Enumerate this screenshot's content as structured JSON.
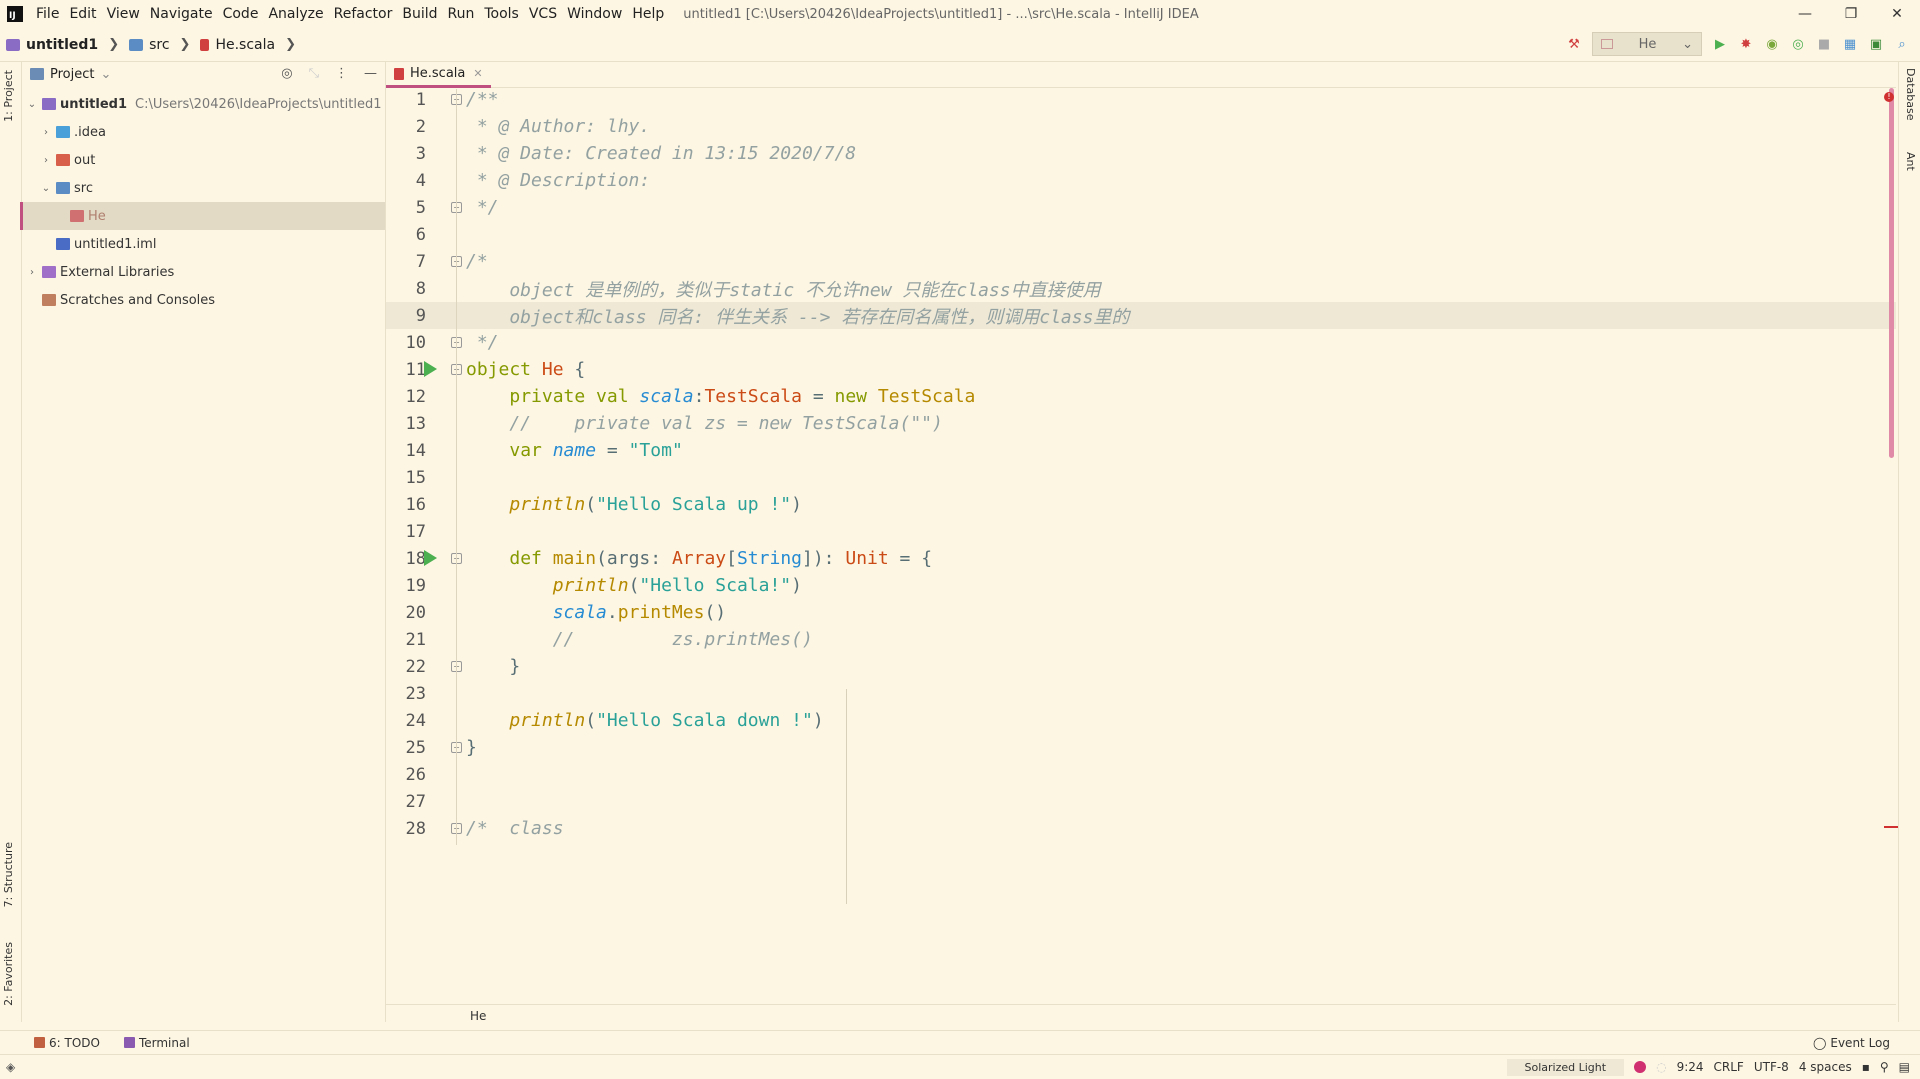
{
  "window": {
    "title": "untitled1 [C:\\Users\\20426\\IdeaProjects\\untitled1] - ...\\src\\He.scala - IntelliJ IDEA",
    "controls": [
      "—",
      "❐",
      "✕"
    ]
  },
  "menu": [
    "File",
    "Edit",
    "View",
    "Navigate",
    "Code",
    "Analyze",
    "Refactor",
    "Build",
    "Run",
    "Tools",
    "VCS",
    "Window",
    "Help"
  ],
  "breadcrumbs": [
    "untitled1",
    "src",
    "He.scala"
  ],
  "run_config": {
    "label": "He"
  },
  "left_stripe": {
    "project": "1: Project",
    "structure": "7: Structure",
    "favorites": "2: Favorites"
  },
  "right_stripe": {
    "database": "Database",
    "ant": "Ant"
  },
  "project_panel": {
    "title": "Project",
    "tree": [
      {
        "label": "untitled1",
        "hint": "C:\\Users\\20426\\IdeaProjects\\untitled1",
        "depth": 0,
        "arrow": "down",
        "icon": "folder-module",
        "bold": true
      },
      {
        "label": ".idea",
        "depth": 1,
        "arrow": "right",
        "icon": "folder-blue"
      },
      {
        "label": "out",
        "depth": 1,
        "arrow": "right",
        "icon": "folder-orange"
      },
      {
        "label": "src",
        "depth": 1,
        "arrow": "down",
        "icon": "folder-src"
      },
      {
        "label": "He",
        "depth": 2,
        "arrow": "",
        "icon": "scala-file",
        "selected": true
      },
      {
        "label": "untitled1.iml",
        "depth": 1,
        "arrow": "",
        "icon": "iml-file"
      },
      {
        "label": "External Libraries",
        "depth": 0,
        "arrow": "right",
        "icon": "libraries"
      },
      {
        "label": "Scratches and Consoles",
        "depth": 0,
        "arrow": "",
        "icon": "scratches"
      }
    ]
  },
  "editor": {
    "tab": "He.scala",
    "current_line": 9,
    "lines": [
      {
        "n": "1",
        "fold": true,
        "run": false,
        "tokens": [
          [
            "c",
            "/**"
          ]
        ]
      },
      {
        "n": "2",
        "tokens": [
          [
            "c",
            " * @ Author: lhy."
          ]
        ]
      },
      {
        "n": "3",
        "tokens": [
          [
            "c",
            " * @ Date: Created in 13:15 2020/7/8"
          ]
        ]
      },
      {
        "n": "4",
        "tokens": [
          [
            "c",
            " * @ Description:"
          ]
        ]
      },
      {
        "n": "5",
        "fold": true,
        "tokens": [
          [
            "c",
            " */"
          ]
        ]
      },
      {
        "n": "6",
        "tokens": []
      },
      {
        "n": "7",
        "fold": true,
        "tokens": [
          [
            "c",
            "/*"
          ]
        ]
      },
      {
        "n": "8",
        "tokens": [
          [
            "c",
            "    object 是单例的，类似于static 不允许new 只能在class中直接使用"
          ]
        ]
      },
      {
        "n": "9",
        "tokens": [
          [
            "c",
            "    object和class 同名: 伴生关系 --> 若存在同名属性，则调用class里的"
          ]
        ]
      },
      {
        "n": "10",
        "fold": true,
        "tokens": [
          [
            "c",
            " */"
          ]
        ]
      },
      {
        "n": "11",
        "fold": true,
        "run": true,
        "tokens": [
          [
            "k",
            "object "
          ],
          [
            "x",
            "He"
          ],
          [
            "p",
            " {"
          ]
        ]
      },
      {
        "n": "12",
        "tokens": [
          [
            "p",
            "    "
          ],
          [
            "k",
            "private val "
          ],
          [
            "v",
            "scala"
          ],
          [
            "p",
            ":"
          ],
          [
            "x",
            "TestScala"
          ],
          [
            "p",
            " = "
          ],
          [
            "k",
            "new "
          ],
          [
            "t",
            "TestScala"
          ]
        ]
      },
      {
        "n": "13",
        "tokens": [
          [
            "c",
            "    //    private val zs = new TestScala(\"\")"
          ]
        ]
      },
      {
        "n": "14",
        "tokens": [
          [
            "p",
            "    "
          ],
          [
            "k",
            "var "
          ],
          [
            "v",
            "name"
          ],
          [
            "p",
            " = "
          ],
          [
            "s",
            "\"Tom\""
          ]
        ]
      },
      {
        "n": "15",
        "tokens": []
      },
      {
        "n": "16",
        "tokens": [
          [
            "p",
            "    "
          ],
          [
            "f",
            "println"
          ],
          [
            "p",
            "("
          ],
          [
            "s",
            "\"Hello Scala up !\""
          ],
          [
            "p",
            ")"
          ]
        ]
      },
      {
        "n": "17",
        "tokens": []
      },
      {
        "n": "18",
        "fold": true,
        "run": true,
        "tokens": [
          [
            "p",
            "    "
          ],
          [
            "k",
            "def "
          ],
          [
            "t",
            "main"
          ],
          [
            "p",
            "(args: "
          ],
          [
            "x",
            "Array"
          ],
          [
            "p",
            "["
          ],
          [
            "y",
            "String"
          ],
          [
            "p",
            "]): "
          ],
          [
            "x",
            "Unit"
          ],
          [
            "p",
            " = {"
          ]
        ]
      },
      {
        "n": "19",
        "tokens": [
          [
            "p",
            "        "
          ],
          [
            "f",
            "println"
          ],
          [
            "p",
            "("
          ],
          [
            "s",
            "\"Hello Scala!\""
          ],
          [
            "p",
            ")"
          ]
        ]
      },
      {
        "n": "20",
        "tokens": [
          [
            "p",
            "        "
          ],
          [
            "v",
            "scala"
          ],
          [
            "p",
            "."
          ],
          [
            "t",
            "printMes"
          ],
          [
            "p",
            "()"
          ]
        ]
      },
      {
        "n": "21",
        "tokens": [
          [
            "c",
            "        //         zs.printMes()"
          ]
        ]
      },
      {
        "n": "22",
        "fold": true,
        "tokens": [
          [
            "p",
            "    }"
          ]
        ]
      },
      {
        "n": "23",
        "tokens": []
      },
      {
        "n": "24",
        "tokens": [
          [
            "p",
            "    "
          ],
          [
            "f",
            "println"
          ],
          [
            "p",
            "("
          ],
          [
            "s",
            "\"Hello Scala down !\""
          ],
          [
            "p",
            ")"
          ]
        ]
      },
      {
        "n": "25",
        "fold": true,
        "tokens": [
          [
            "p",
            "}"
          ]
        ]
      },
      {
        "n": "26",
        "tokens": []
      },
      {
        "n": "27",
        "tokens": []
      },
      {
        "n": "28",
        "fold": true,
        "tokens": [
          [
            "c",
            "/*  class"
          ]
        ]
      }
    ],
    "bottom_crumb": "He"
  },
  "bottom_tools": {
    "todo": "6: TODO",
    "terminal": "Terminal",
    "event_log": "Event Log"
  },
  "status": {
    "theme": "Solarized Light",
    "position": "9:24",
    "line_sep": "CRLF",
    "encoding": "UTF-8",
    "indent": "4 spaces"
  },
  "colors": {
    "accent": "#c05080",
    "run": "#4caf50",
    "error": "#d03030",
    "background": "#fdf6e3"
  }
}
